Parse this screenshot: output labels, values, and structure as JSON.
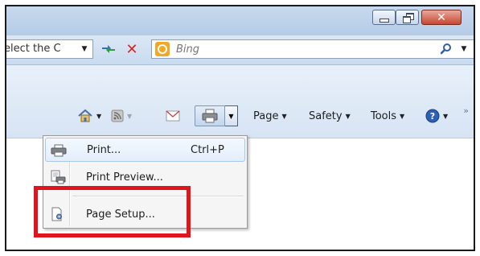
{
  "address_bar": {
    "url_text": "elect the C",
    "search_placeholder": "Bing"
  },
  "command_bar": {
    "items": [
      {
        "label": "Page"
      },
      {
        "label": "Safety"
      },
      {
        "label": "Tools"
      }
    ],
    "overflow": "»"
  },
  "print_menu": {
    "items": [
      {
        "label": "Print...",
        "shortcut": "Ctrl+P"
      },
      {
        "label": "Print Preview..."
      },
      {
        "label": "Page Setup..."
      }
    ]
  },
  "colors": {
    "highlight": "#e0141c",
    "close_button": "#c74732",
    "search_logo": "#f5a623"
  }
}
